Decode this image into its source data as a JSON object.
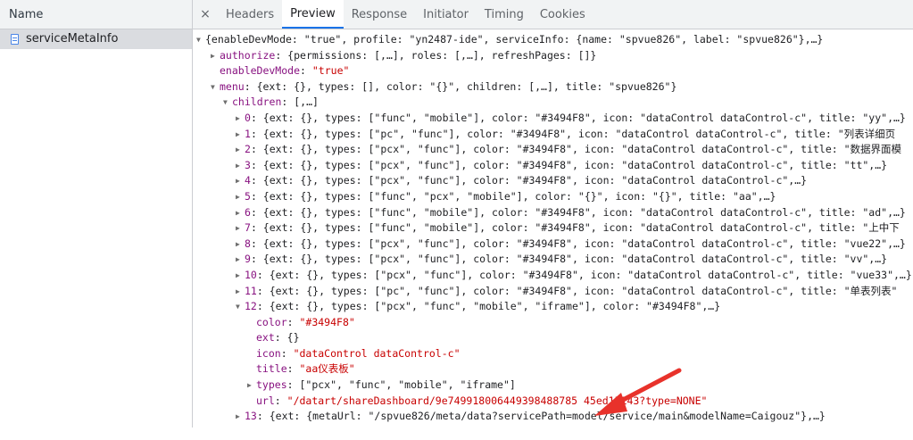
{
  "left_panel": {
    "header": "Name",
    "file": "serviceMetaInfo"
  },
  "tabs": {
    "close": "×",
    "items": [
      "Headers",
      "Preview",
      "Response",
      "Initiator",
      "Timing",
      "Cookies"
    ],
    "active": "Preview"
  },
  "tree": {
    "root_summary": "{enableDevMode: \"true\", profile: \"yn2487-ide\", serviceInfo: {name: \"spvue826\", label: \"spvue826\"},…}",
    "authorize_key": "authorize",
    "authorize_val": "{permissions: [,…], roles: [,…], refreshPages: []}",
    "enableDevMode_key": "enableDevMode",
    "enableDevMode_val": "\"true\"",
    "menu_key": "menu",
    "menu_val": "{ext: {}, types: [], color: \"{}\", children: [,…], title: \"spvue826\"}",
    "children_key": "children",
    "children_val": "[,…]",
    "children": [
      {
        "idx": "0",
        "text": "{ext: {}, types: [\"func\", \"mobile\"], color: \"#3494F8\", icon: \"dataControl dataControl-c\", title: \"yy\",…}"
      },
      {
        "idx": "1",
        "text": "{ext: {}, types: [\"pc\", \"func\"], color: \"#3494F8\", icon: \"dataControl dataControl-c\", title: \"列表详细页"
      },
      {
        "idx": "2",
        "text": "{ext: {}, types: [\"pcx\", \"func\"], color: \"#3494F8\", icon: \"dataControl dataControl-c\", title: \"数据界面模"
      },
      {
        "idx": "3",
        "text": "{ext: {}, types: [\"pcx\", \"func\"], color: \"#3494F8\", icon: \"dataControl dataControl-c\", title: \"tt\",…}"
      },
      {
        "idx": "4",
        "text": "{ext: {}, types: [\"pcx\", \"func\"], color: \"#3494F8\", icon: \"dataControl dataControl-c\",…}"
      },
      {
        "idx": "5",
        "text": "{ext: {}, types: [\"func\", \"pcx\", \"mobile\"], color: \"{}\", icon: \"{}\", title: \"aa\",…}"
      },
      {
        "idx": "6",
        "text": "{ext: {}, types: [\"func\", \"mobile\"], color: \"#3494F8\", icon: \"dataControl dataControl-c\", title: \"ad\",…}"
      },
      {
        "idx": "7",
        "text": "{ext: {}, types: [\"func\", \"mobile\"], color: \"#3494F8\", icon: \"dataControl dataControl-c\", title: \"上中下"
      },
      {
        "idx": "8",
        "text": "{ext: {}, types: [\"pcx\", \"func\"], color: \"#3494F8\", icon: \"dataControl dataControl-c\", title: \"vue22\",…}"
      },
      {
        "idx": "9",
        "text": "{ext: {}, types: [\"pcx\", \"func\"], color: \"#3494F8\", icon: \"dataControl dataControl-c\", title: \"vv\",…}"
      },
      {
        "idx": "10",
        "text": "{ext: {}, types: [\"pcx\", \"func\"], color: \"#3494F8\", icon: \"dataControl dataControl-c\", title: \"vue33\",…}"
      },
      {
        "idx": "11",
        "text": "{ext: {}, types: [\"pc\", \"func\"], color: \"#3494F8\", icon: \"dataControl dataControl-c\", title: \"单表列表\""
      }
    ],
    "item12": {
      "idx": "12",
      "text": "{ext: {}, types: [\"pcx\", \"func\", \"mobile\", \"iframe\"], color: \"#3494F8\",…}",
      "color_key": "color",
      "color_val": "\"#3494F8\"",
      "ext_key": "ext",
      "ext_val": "{}",
      "icon_key": "icon",
      "icon_val": "\"dataControl dataControl-c\"",
      "title_key": "title",
      "title_val": "\"aa仪表板\"",
      "types_key": "types",
      "types_val": "[\"pcx\", \"func\", \"mobile\", \"iframe\"]",
      "url_key": "url",
      "url_val": "\"/datart/shareDashboard/9e749918006449398488785 45ed15143?type=NONE\""
    },
    "item13": {
      "idx": "13",
      "text": "{ext: {metaUrl: \"/spvue826/meta/data?servicePath=model/service/main&modelName=Caigouz\"},…}"
    },
    "colors": {
      "key": "#881280",
      "string": "#c80000",
      "arrow": "#e8322b"
    }
  }
}
